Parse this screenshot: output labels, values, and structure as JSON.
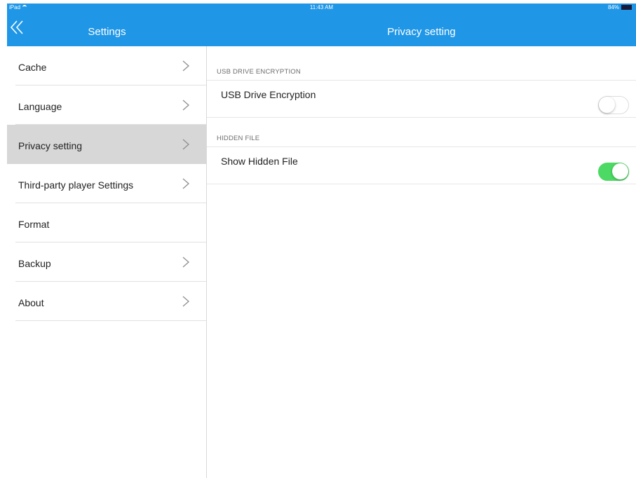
{
  "status_bar": {
    "device": "iPad",
    "time": "11:43 AM",
    "battery": "84%"
  },
  "sidebar": {
    "title": "Settings",
    "back_icon": "double-chevron-left-icon",
    "items": [
      {
        "label": "Cache",
        "has_chevron": true,
        "selected": false
      },
      {
        "label": "Language",
        "has_chevron": true,
        "selected": false
      },
      {
        "label": "Privacy setting",
        "has_chevron": true,
        "selected": true
      },
      {
        "label": "Third-party player Settings",
        "has_chevron": true,
        "selected": false
      },
      {
        "label": "Format",
        "has_chevron": false,
        "selected": false
      },
      {
        "label": "Backup",
        "has_chevron": true,
        "selected": false
      },
      {
        "label": "About",
        "has_chevron": true,
        "selected": false
      }
    ]
  },
  "main": {
    "title": "Privacy setting",
    "sections": [
      {
        "header": "USB DRIVE ENCRYPTION",
        "row_label": "USB Drive Encryption",
        "toggle_on": false
      },
      {
        "header": "HIDDEN FILE",
        "row_label": "Show Hidden File",
        "toggle_on": true
      }
    ]
  },
  "colors": {
    "nav_bar": "#1f96e6",
    "toggle_on": "#4cd964",
    "selected_row": "#d7d7d7"
  }
}
